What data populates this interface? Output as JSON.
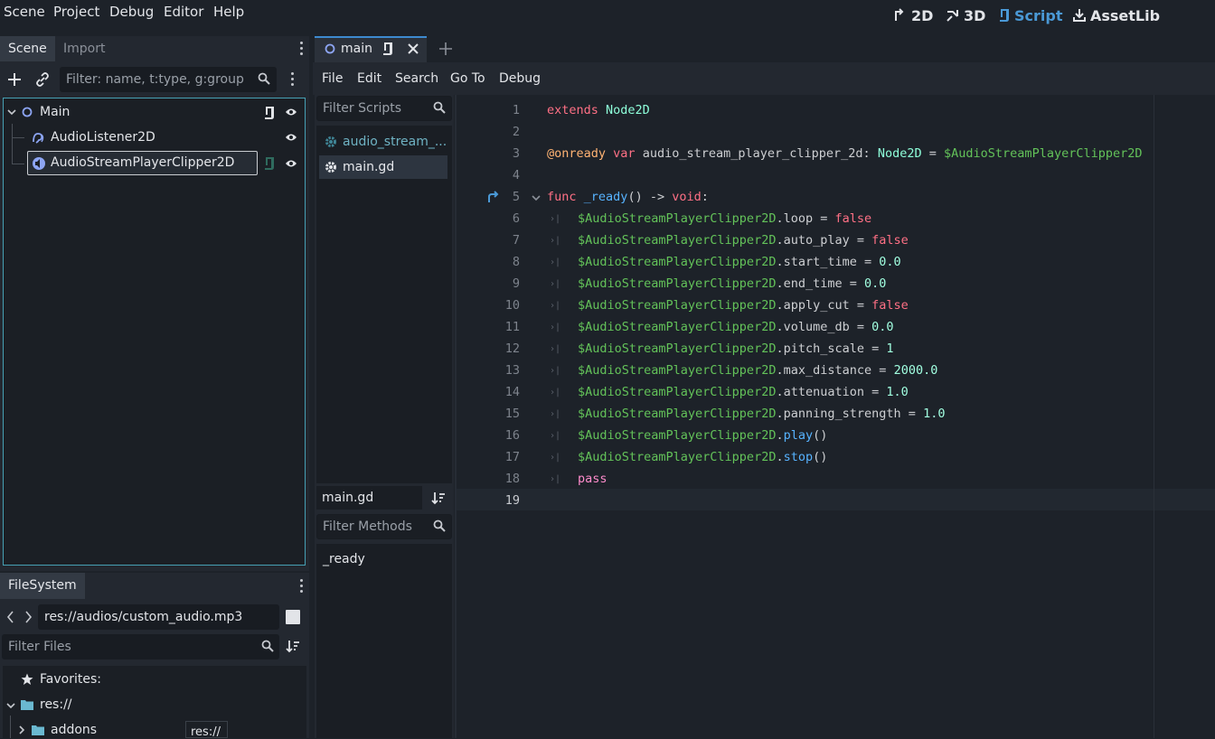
{
  "menu": {
    "items": [
      "Scene",
      "Project",
      "Debug",
      "Editor",
      "Help"
    ]
  },
  "workspaces": {
    "btn_2d": "2D",
    "btn_3d": "3D",
    "btn_script": "Script",
    "btn_assetlib": "AssetLib",
    "active": "Script"
  },
  "scene_dock": {
    "tabs": [
      "Scene",
      "Import"
    ],
    "filter_placeholder": "Filter: name, t:type, g:group",
    "tree": [
      {
        "label": "Main",
        "icon": "node2d-icon",
        "expanded": true,
        "has_script": true,
        "visible": true
      },
      {
        "label": "AudioListener2D",
        "icon": "audio-listener-icon",
        "visible": true
      },
      {
        "label": "AudioStreamPlayerClipper2D",
        "icon": "audio-stream-player-icon",
        "selected": true,
        "has_script": true,
        "visible": true
      }
    ]
  },
  "filesystem": {
    "tab": "FileSystem",
    "path": "res://audios/custom_audio.mp3",
    "filter_placeholder": "Filter Files",
    "tree": [
      {
        "label": "Favorites:",
        "icon": "star-icon"
      },
      {
        "label": "res://",
        "icon": "folder-icon",
        "expanded": true
      },
      {
        "label": "addons",
        "icon": "folder-icon",
        "expanded": false
      }
    ],
    "tooltip": "res://"
  },
  "editor": {
    "tab_label": "main",
    "menu": [
      "File",
      "Edit",
      "Search",
      "Go To",
      "Debug"
    ],
    "filter_scripts_placeholder": "Filter Scripts",
    "scripts": [
      {
        "label": "audio_stream_...",
        "active": false
      },
      {
        "label": "main.gd",
        "active": true
      }
    ],
    "current_script": "main.gd",
    "filter_methods_placeholder": "Filter Methods",
    "methods": [
      "_ready"
    ],
    "current_line": 19
  },
  "code_lines": [
    "extends Node2D",
    "",
    "@onready var audio_stream_player_clipper_2d: Node2D = $AudioStreamPlayerClipper2D",
    "",
    "func _ready() -> void:",
    "\t$AudioStreamPlayerClipper2D.loop = false",
    "\t$AudioStreamPlayerClipper2D.auto_play = false",
    "\t$AudioStreamPlayerClipper2D.start_time = 0.0",
    "\t$AudioStreamPlayerClipper2D.end_time = 0.0",
    "\t$AudioStreamPlayerClipper2D.apply_cut = false",
    "\t$AudioStreamPlayerClipper2D.volume_db = 0.0",
    "\t$AudioStreamPlayerClipper2D.pitch_scale = 1",
    "\t$AudioStreamPlayerClipper2D.max_distance = 2000.0",
    "\t$AudioStreamPlayerClipper2D.attenuation = 1.0",
    "\t$AudioStreamPlayerClipper2D.panning_strength = 1.0",
    "\t$AudioStreamPlayerClipper2D.play()",
    "\t$AudioStreamPlayerClipper2D.stop()",
    "\tpass",
    ""
  ],
  "colors": {
    "accent": "#4a99d6",
    "keyword": "#ff7085",
    "type": "#8effda",
    "node_path": "#63c259",
    "number": "#a1ffe0",
    "annotation": "#ffb373",
    "selection_border": "#46a0b4"
  }
}
